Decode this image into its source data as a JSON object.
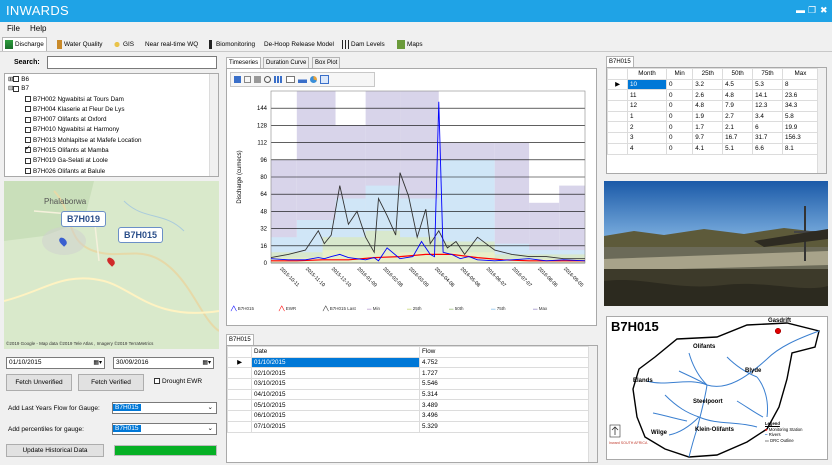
{
  "app": {
    "title": "INWARDS",
    "controls": {
      "min": "▬",
      "max": "❐",
      "close": "✖"
    }
  },
  "menu": {
    "file": "File",
    "help": "Help"
  },
  "tabs": [
    {
      "label": "Discharge",
      "icon": "discharge-icon"
    },
    {
      "label": "Water Quality",
      "icon": "water-quality-icon"
    },
    {
      "label": "GIS",
      "icon": "gis-icon"
    },
    {
      "label": "Near real-time WQ",
      "icon": "realtime-icon"
    },
    {
      "label": "Biomonitoring",
      "icon": "biomonitoring-icon"
    },
    {
      "label": "De-Hoop Release Model",
      "icon": "dam-model-icon"
    },
    {
      "label": "Dam Levels",
      "icon": "dam-levels-icon"
    },
    {
      "label": "Maps",
      "icon": "maps-icon"
    }
  ],
  "search": {
    "label": "Search:",
    "value": ""
  },
  "tree": [
    {
      "label": "B6",
      "level": 0,
      "expander": "⊞"
    },
    {
      "label": "B7",
      "level": 0,
      "expander": "⊟"
    },
    {
      "label": "B7H002 Ngwabitsi at Tours Dam",
      "level": 1,
      "checked": false
    },
    {
      "label": "B7H004 Klaserie at Fleur De Lys",
      "level": 1,
      "checked": false
    },
    {
      "label": "B7H007 Olifants at Oxford",
      "level": 1,
      "checked": false
    },
    {
      "label": "B7H010 Ngwabitsi at Harmony",
      "level": 1,
      "checked": false
    },
    {
      "label": "B7H013 Mohlapitse at Mafefe Location",
      "level": 1,
      "checked": false
    },
    {
      "label": "B7H015 Olifants at Mamba",
      "level": 1,
      "checked": true
    },
    {
      "label": "B7H019 Ga-Selati at Loole",
      "level": 1,
      "checked": false
    },
    {
      "label": "B7H026 Olifants at Balule",
      "level": 1,
      "checked": false
    }
  ],
  "map": {
    "town": "Phalaborwa",
    "gauge1": "B7H019",
    "gauge2": "B7H015",
    "attribution": "©2019 Google - Map data ©2019 Tele Atlas , Imagery ©2019 TerraMetrics"
  },
  "dates": {
    "start": "01/10/2015",
    "end": "30/09/2016"
  },
  "buttons": {
    "fetch_unverified": "Fetch Unverified",
    "fetch_verified": "Fetch Verified",
    "drought": "Drought EWR",
    "update": "Update Historical Data"
  },
  "last_year": {
    "label": "Add Last Years Flow for Gauge:",
    "value": "B7H015"
  },
  "percentiles": {
    "label": "Add percentiles for gauge:",
    "value": "B7H015"
  },
  "chart_tabs": [
    "Timeseries",
    "Duration Curve",
    "Box Plot"
  ],
  "chart_data": {
    "type": "line",
    "ylabel": "Discharge (cumecs)",
    "ylim": [
      0,
      160
    ],
    "yticks": [
      0,
      16,
      32,
      48,
      64,
      80,
      96,
      112,
      128,
      144
    ],
    "xticks": [
      "2015-10-11",
      "2015-11-10",
      "2015-12-10",
      "2016-01-09",
      "2016-02-08",
      "2016-03-09",
      "2016-04-08",
      "2016-05-08",
      "2016-06-07",
      "2016-07-07",
      "2016-08-06",
      "2016-09-05"
    ],
    "legend": [
      "B7H015",
      "EWR",
      "B7H015 Last",
      "Min",
      "25th",
      "50th",
      "75th",
      "Max"
    ],
    "colors": {
      "B7H015": "#0000ff",
      "EWR": "#ff0000",
      "B7H015 Last": "#333333",
      "Min": "#e8d9ee",
      "25th": "#eaf0c8",
      "50th": "#d8e8c8",
      "75th": "#cfe8f8",
      "Max": "#d4cfe8"
    },
    "series": [
      {
        "name": "B7H015",
        "x": [
          0,
          20,
          40,
          55,
          62,
          70,
          80,
          90,
          100,
          110,
          120,
          125,
          135,
          150,
          165,
          175,
          185,
          190,
          195,
          200,
          210,
          220,
          230,
          240,
          260,
          280,
          300,
          320,
          340,
          365
        ],
        "y": [
          4,
          3,
          3,
          5,
          4,
          6,
          8,
          5,
          4,
          3,
          5,
          2,
          14,
          4,
          6,
          20,
          8,
          6,
          150,
          10,
          8,
          4,
          6,
          3,
          2,
          3,
          4,
          2,
          3,
          2
        ]
      },
      {
        "name": "EWR",
        "x": [
          0,
          30,
          60,
          90,
          120,
          150,
          180,
          210,
          240,
          270,
          300,
          330,
          365
        ],
        "y": [
          2,
          2,
          3,
          3,
          5,
          6,
          8,
          8,
          5,
          3,
          2,
          2,
          2
        ]
      },
      {
        "name": "B7H015 Last",
        "x": [
          0,
          20,
          40,
          55,
          62,
          70,
          80,
          90,
          100,
          110,
          120,
          125,
          135,
          145,
          150,
          160,
          170,
          180,
          185,
          195,
          205,
          215,
          225,
          240,
          260,
          280,
          300,
          320,
          340,
          365
        ],
        "y": [
          5,
          8,
          12,
          30,
          18,
          26,
          72,
          36,
          48,
          24,
          10,
          60,
          44,
          26,
          84,
          62,
          24,
          50,
          18,
          30,
          14,
          20,
          8,
          24,
          12,
          8,
          6,
          6,
          4,
          4
        ]
      }
    ]
  },
  "flow_tab": "B7H015",
  "flow_table": {
    "headers": [
      "Date",
      "Flow"
    ],
    "rows": [
      [
        "01/10/2015",
        "4.752"
      ],
      [
        "02/10/2015",
        "1.727"
      ],
      [
        "03/10/2015",
        "5.546"
      ],
      [
        "04/10/2015",
        "5.314"
      ],
      [
        "05/10/2015",
        "3.489"
      ],
      [
        "06/10/2015",
        "3.496"
      ],
      [
        "07/10/2015",
        "5.329"
      ]
    ]
  },
  "monthly_tab": "B7H015",
  "monthly_table": {
    "headers": [
      "Month",
      "Min",
      "25th",
      "50th",
      "75th",
      "Max"
    ],
    "rows": [
      [
        "10",
        "0",
        "3.2",
        "4.5",
        "5.3",
        "8"
      ],
      [
        "11",
        "0",
        "2.6",
        "4.8",
        "14.1",
        "23.6"
      ],
      [
        "12",
        "0",
        "4.8",
        "7.9",
        "12.3",
        "34.3"
      ],
      [
        "1",
        "0",
        "1.9",
        "2.7",
        "3.4",
        "5.8"
      ],
      [
        "2",
        "0",
        "1.7",
        "2.1",
        "6",
        "19.9"
      ],
      [
        "3",
        "0",
        "9.7",
        "16.7",
        "31.7",
        "156.3"
      ],
      [
        "4",
        "0",
        "4.1",
        "5.1",
        "6.6",
        "8.1"
      ]
    ]
  },
  "river_map": {
    "title": "B7H015",
    "places": [
      "Gasdrift",
      "Olifants",
      "Blyde",
      "Elands",
      "Steelpoort",
      "Klein-Olifants",
      "Wilge"
    ],
    "legend_title": "Legend",
    "legend_items": [
      "Monitoring Station",
      "Rivers",
      "DRC Outline"
    ],
    "logo_text": "Inward SOUTH AFRICA"
  }
}
